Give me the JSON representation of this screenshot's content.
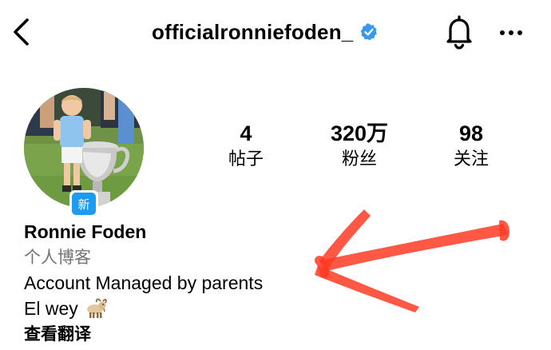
{
  "header": {
    "username": "officialronniefoden_",
    "back_icon": "chevron-left-icon",
    "verified_icon": "verified-badge-icon",
    "bell_icon": "bell-icon",
    "more_icon": "more-horizontal-icon",
    "verified_color": "#3897f0"
  },
  "profile": {
    "new_badge": "新",
    "stats": {
      "posts_count": "4",
      "posts_label": "帖子",
      "followers_count": "320万",
      "followers_label": "粉丝",
      "following_count": "98",
      "following_label": "关注"
    },
    "display_name": "Ronnie Foden",
    "category": "个人博客",
    "bio_line_1": "Account Managed by parents",
    "bio_line_2": "El wey",
    "bio_emoji": "goat-emoji-icon",
    "see_translation": "查看翻译"
  },
  "annotation": {
    "arrow_color": "#ff3b25",
    "arrow_icon": "hand-drawn-arrow-icon"
  }
}
